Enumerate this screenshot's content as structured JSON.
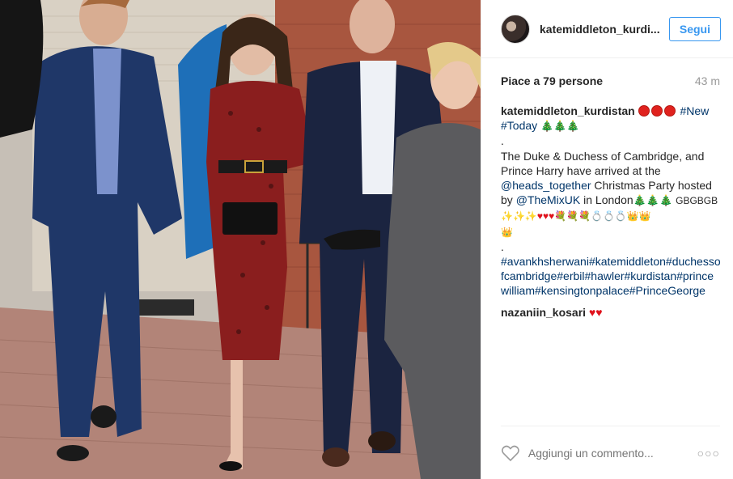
{
  "header": {
    "username": "katemiddleton_kurdi...",
    "follow_label": "Segui"
  },
  "likes": {
    "text": "Piace a 79 persone",
    "time": "43 m"
  },
  "caption": {
    "user": "katemiddleton_kurdistan",
    "tag_new": "#New",
    "tag_today": "#Today",
    "dot": ".",
    "text_1": "The Duke & Duchess of Cambridge, and Prince Harry have arrived at the",
    "mention_1": "@heads_together",
    "text_2": " Christmas Party hosted by ",
    "mention_2": "@TheMixUK",
    "text_3": " in London",
    "gb_text": "GBGBGB",
    "dot2": ".",
    "hashtags": "#avankhsherwani#katemiddleton#duchessofcambridge#erbil#hawler#kurdistan#princewilliam#kensingtonpalace#PrinceGeorge"
  },
  "comment2": {
    "user": "nazaniin_kosari"
  },
  "bottom": {
    "comment_placeholder": "Aggiungi un commento...",
    "more": "○○○"
  },
  "icons": {
    "heart": "heart-outline-icon",
    "more": "ellipsis-icon"
  },
  "colors": {
    "link": "#003569",
    "follow": "#3897f0",
    "muted": "#999999"
  }
}
